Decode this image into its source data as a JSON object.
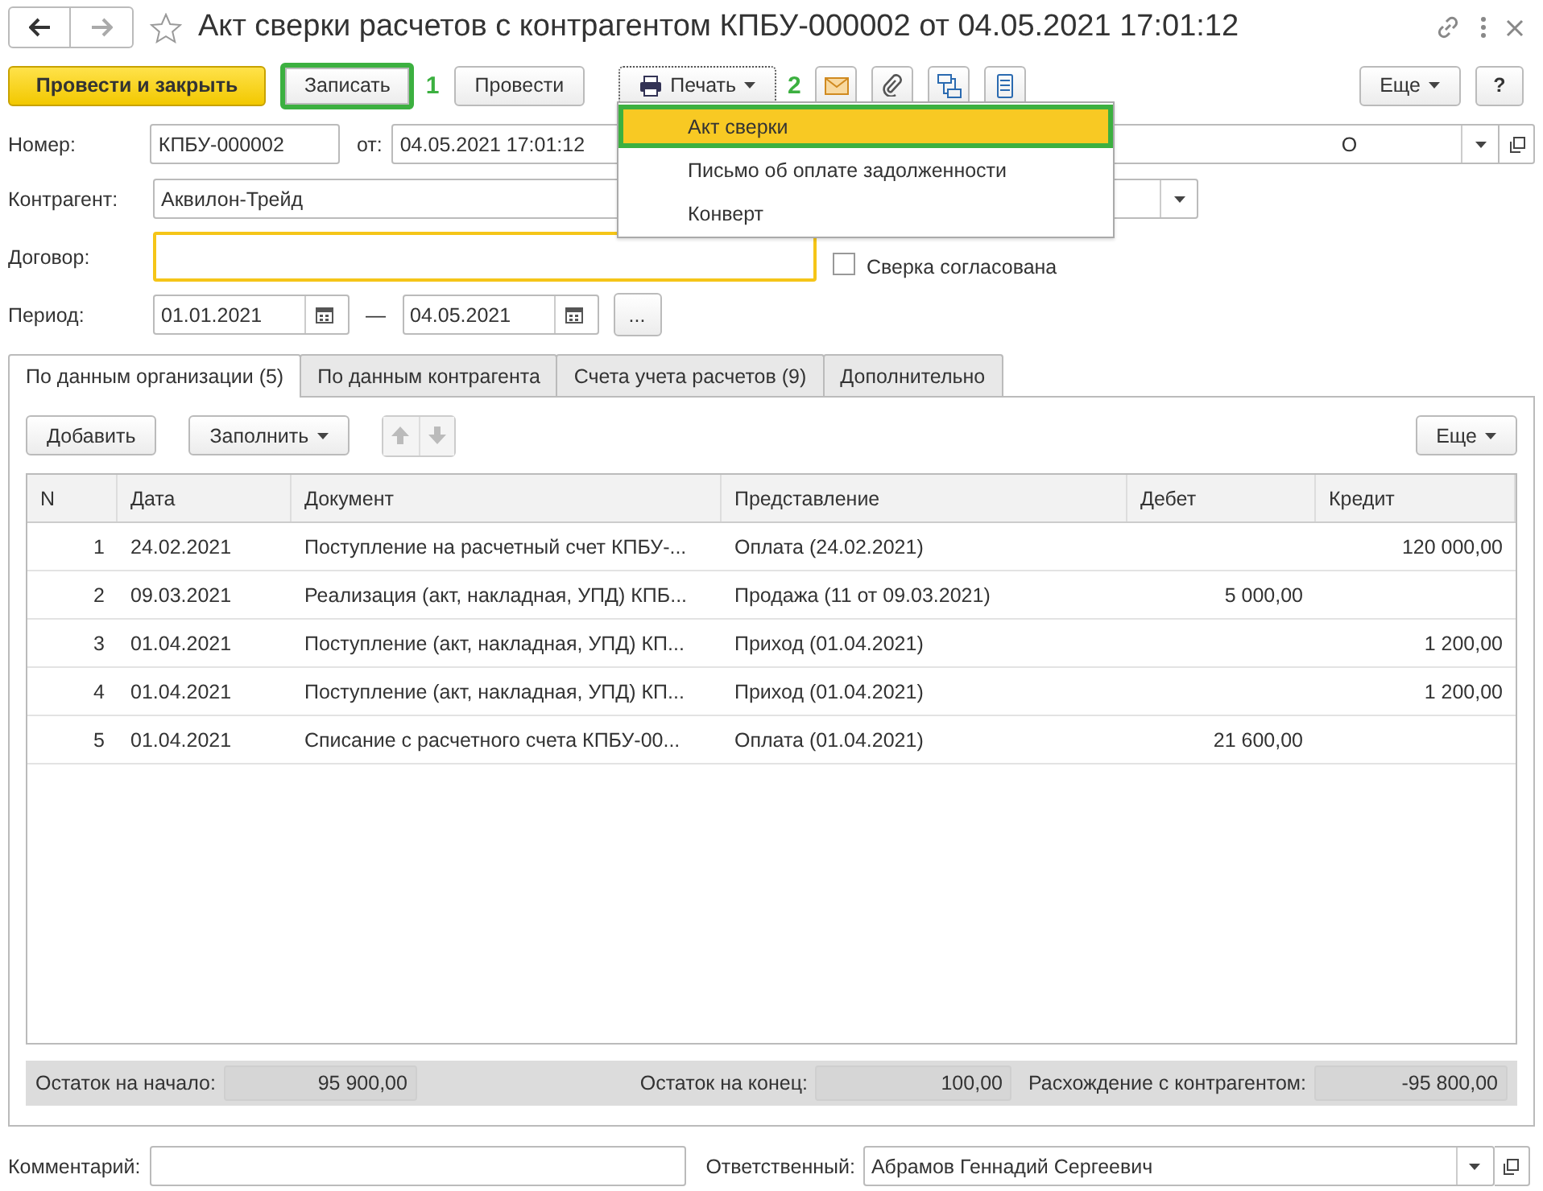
{
  "window": {
    "title": "Акт сверки расчетов с контрагентом КПБУ-000002 от 04.05.2021 17:01:12"
  },
  "toolbar": {
    "buttons": [
      {
        "kind": "primary",
        "label": "Провести и закрыть",
        "highlighted": false
      },
      {
        "kind": "text",
        "label": "Записать",
        "highlighted": true,
        "callout": "1"
      },
      {
        "kind": "text",
        "label": "Провести",
        "highlighted": false
      },
      {
        "kind": "menu",
        "label": "Печать",
        "highlighted": false,
        "callout": "2"
      },
      {
        "kind": "envelope",
        "highlighted": false
      },
      {
        "kind": "clip",
        "highlighted": false
      },
      {
        "kind": "structure",
        "highlighted": false
      },
      {
        "kind": "list",
        "highlighted": false
      }
    ],
    "more": "Еще",
    "help": "?"
  },
  "print_menu": {
    "items": [
      {
        "label": "Акт сверки",
        "selected": true,
        "highlighted": true
      },
      {
        "label": "Письмо об оплате задолженности",
        "selected": false,
        "highlighted": false
      },
      {
        "label": "Конверт",
        "selected": false,
        "highlighted": false
      }
    ]
  },
  "form": {
    "number": {
      "label": "Номер:",
      "value": "КПБУ-000002"
    },
    "date": {
      "label": "от:",
      "value": "04.05.2021 17:01:12"
    },
    "organization": {
      "value": "О"
    },
    "counterparty": {
      "label": "Контрагент:",
      "value": "Аквилон-Трейд"
    },
    "contract": {
      "label": "Договор:"
    },
    "agreed": {
      "label": "Сверка согласована",
      "checked": false
    },
    "period": {
      "label": "Период:",
      "from": "01.01.2021",
      "separator": "—",
      "to": "04.05.2021",
      "more": "..."
    }
  },
  "tabs": [
    {
      "label": "По данным организации (5)",
      "selected": true
    },
    {
      "label": "По данным контрагента",
      "selected": false
    },
    {
      "label": "Счета учета расчетов (9)",
      "selected": false
    },
    {
      "label": "Дополнительно",
      "selected": false
    }
  ],
  "table_toolbar": {
    "add": "Добавить",
    "fill": "Заполнить",
    "more": "Еще"
  },
  "table": {
    "columns": [
      "N",
      "Дата",
      "Документ",
      "Представление",
      "Дебет",
      "Кредит"
    ],
    "rows": [
      [
        "1",
        "24.02.2021",
        "Поступление на расчетный счет КПБУ-...",
        "Оплата (24.02.2021)",
        "",
        "120 000,00"
      ],
      [
        "2",
        "09.03.2021",
        "Реализация (акт, накладная, УПД) КПБ...",
        "Продажа (11 от 09.03.2021)",
        "5 000,00",
        ""
      ],
      [
        "3",
        "01.04.2021",
        "Поступление (акт, накладная, УПД) КП...",
        "Приход (01.04.2021)",
        "",
        "1 200,00"
      ],
      [
        "4",
        "01.04.2021",
        "Поступление (акт, накладная, УПД) КП...",
        "Приход (01.04.2021)",
        "",
        "1 200,00"
      ],
      [
        "5",
        "01.04.2021",
        "Списание с расчетного счета КПБУ-00...",
        "Оплата (01.04.2021)",
        "21 600,00",
        ""
      ]
    ]
  },
  "totals": [
    {
      "label": "Остаток на начало:",
      "value": "95 900,00"
    },
    {
      "label": "Остаток на конец:",
      "value": "100,00"
    },
    {
      "label": "Расхождение с контрагентом:",
      "value": "-95 800,00"
    }
  ],
  "footer": {
    "comment": {
      "label": "Комментарий:"
    },
    "responsible": {
      "label": "Ответственный:",
      "value": "Абрамов Геннадий Сергеевич"
    }
  }
}
